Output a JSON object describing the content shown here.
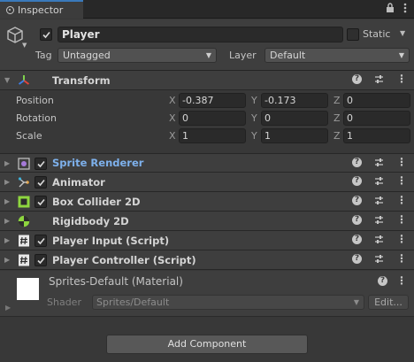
{
  "tab": {
    "title": "Inspector",
    "lock_icon": "lock-icon",
    "menu_icon": "kebab-menu-icon"
  },
  "header": {
    "name": "Player",
    "active": true,
    "static_label": "Static",
    "static": false,
    "tag_label": "Tag",
    "tag_value": "Untagged",
    "layer_label": "Layer",
    "layer_value": "Default"
  },
  "transform": {
    "title": "Transform",
    "rows": [
      {
        "label": "Position",
        "x": "-0.387",
        "y": "-0.173",
        "z": "0"
      },
      {
        "label": "Rotation",
        "x": "0",
        "y": "0",
        "z": "0"
      },
      {
        "label": "Scale",
        "x": "1",
        "y": "1",
        "z": "1"
      }
    ],
    "axis_x": "X",
    "axis_y": "Y",
    "axis_z": "Z"
  },
  "components": [
    {
      "title": "Sprite Renderer",
      "icon": "sprite-renderer-icon",
      "enabled": true,
      "highlight": true
    },
    {
      "title": "Animator",
      "icon": "animator-icon",
      "enabled": true
    },
    {
      "title": "Box Collider 2D",
      "icon": "box-collider-icon",
      "enabled": true
    },
    {
      "title": "Rigidbody 2D",
      "icon": "rigidbody-icon",
      "enabled": null
    },
    {
      "title": "Player Input (Script)",
      "icon": "script-icon",
      "enabled": true
    },
    {
      "title": "Player Controller (Script)",
      "icon": "script-icon",
      "enabled": true
    }
  ],
  "material": {
    "title": "Sprites-Default (Material)",
    "shader_label": "Shader",
    "shader_value": "Sprites/Default",
    "edit_label": "Edit..."
  },
  "add_component_label": "Add Component",
  "colors": {
    "accent": "#3a79bb",
    "highlight_text": "#7eb1ec",
    "background": "#383838"
  }
}
